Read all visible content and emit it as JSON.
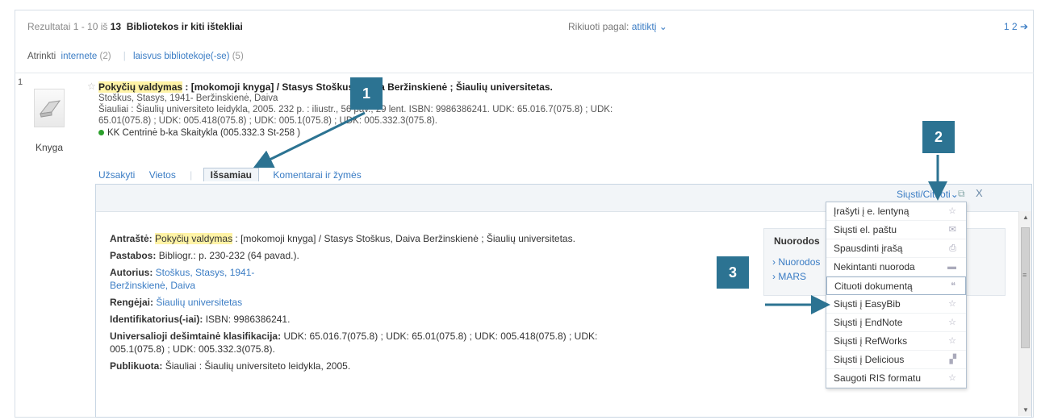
{
  "topbar": {
    "results_prefix": "Rezultatai 1 - 10 iš ",
    "results_total": "13",
    "results_title": "Bibliotekos ir kiti ištekliai",
    "sort_label": "Rikiuoti pagal:",
    "sort_value": "atitiktį",
    "pages": "1 2"
  },
  "filters": {
    "label": "Atrinkti",
    "f1": "internete",
    "f1_count": "(2)",
    "f2": "laisvus bibliotekoje(-se)",
    "f2_count": "(5)"
  },
  "record": {
    "number": "1",
    "type_label": "Knyga",
    "title_hl": "Pokyčių valdymas",
    "title_rest": " : [mokomoji knyga] / Stasys Stoškus, Daiva Beržinskienė ; Šiaulių universitetas.",
    "line2": "Stoškus, Stasys, 1941- Beržinskienė, Daiva",
    "line3": "Šiauliai : Šiaulių universiteto leidykla, 2005. 232 p. : iliustr., 56 pav., 29 lent. ISBN: 9986386241. UDK: 65.016.7(075.8) ; UDK:",
    "line4": "65.01(075.8) ; UDK: 005.418(075.8) ; UDK: 005.1(075.8) ; UDK: 005.332.3(075.8).",
    "availability": "KK Centrinė b-ka Skaitykla (005.332.3 St-258 )"
  },
  "tabs": [
    "Užsakyti",
    "Vietos",
    "Išsamiau",
    "Komentarai ir žymės"
  ],
  "panel": {
    "send_label": "Siųsti/Cituoti",
    "pop_icon": "⧉",
    "close_icon": "X"
  },
  "details": {
    "title_label": "Antraštė:",
    "title_hl": "Pokyčių valdymas",
    "title_rest": " : [mokomoji knyga] / Stasys Stoškus, Daiva Beržinskienė ; Šiaulių universitetas.",
    "notes_label": "Pastabos:",
    "notes_value": "Bibliogr.: p. 230-232 (64 pavad.).",
    "author_label": "Autorius:",
    "author1": "Stoškus, Stasys, 1941-",
    "author2": "Beržinskienė, Daiva",
    "org_label": "Rengėjai:",
    "org_value": "Šiaulių universitetas",
    "id_label": "Identifikatorius(-iai):",
    "id_value": "ISBN: 9986386241.",
    "udc_label": "Universalioji dešimtainė klasifikacija:",
    "udc_value": "UDK: 65.016.7(075.8) ; UDK: 65.01(075.8) ; UDK: 005.418(075.8) ; UDK: 005.1(075.8) ; UDK: 005.332.3(075.8).",
    "pub_label": "Publikuota:",
    "pub_value": "Šiauliai : Šiaulių universiteto leidykla, 2005."
  },
  "refbox": {
    "title": "Nuorodos",
    "link1": "› Nuorodos",
    "link2": "› MARS"
  },
  "menu": [
    {
      "label": "Įrašyti į e. lentyną",
      "icon": "☆"
    },
    {
      "label": "Siųsti el. paštu",
      "icon": "✉"
    },
    {
      "label": "Spausdinti įrašą",
      "icon": "⎙"
    },
    {
      "label": "Nekintanti nuoroda",
      "icon": "▬"
    },
    {
      "label": "Cituoti dokumentą",
      "icon": "❝"
    },
    {
      "label": "Siųsti į EasyBib",
      "icon": "☆"
    },
    {
      "label": "Siųsti į EndNote",
      "icon": "☆"
    },
    {
      "label": "Siųsti į RefWorks",
      "icon": "☆"
    },
    {
      "label": "Siųsti į Delicious",
      "icon": "▞"
    },
    {
      "label": "Saugoti RIS formatu",
      "icon": "☆"
    }
  ],
  "callouts": [
    "1",
    "2",
    "3"
  ],
  "colors": {
    "accent": "#2c7392",
    "link": "#3a7cc4",
    "highlight": "#fff3a6"
  }
}
